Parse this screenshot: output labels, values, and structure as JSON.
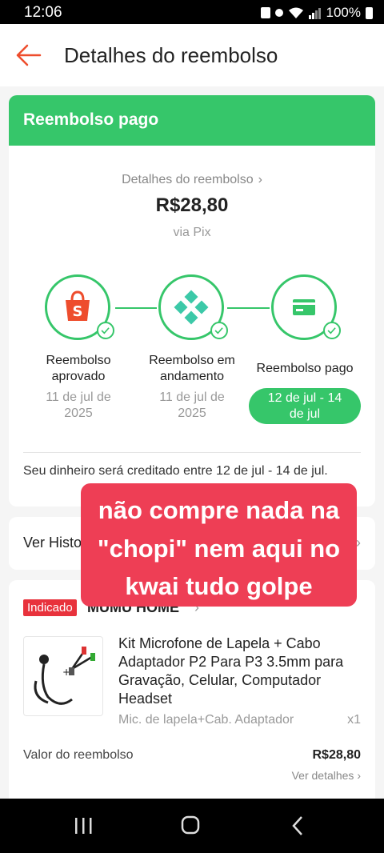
{
  "status_bar": {
    "time": "12:06",
    "battery": "100%"
  },
  "header": {
    "title": "Detalhes do reembolso"
  },
  "refund_card": {
    "banner": "Reembolso pago",
    "details_link": "Detalhes do reembolso",
    "amount": "R$28,80",
    "method": "via Pix",
    "steps": [
      {
        "label_line1": "Reembolso",
        "label_line2": "aprovado",
        "date_line1": "11 de jul de",
        "date_line2": "2025"
      },
      {
        "label_line1": "Reembolso em",
        "label_line2": "andamento",
        "date_line1": "11 de jul de",
        "date_line2": "2025"
      },
      {
        "label_line1": "Reembolso pago",
        "label_line2": "",
        "date_line1": "12 de jul - 14",
        "date_line2": "de jul"
      }
    ],
    "credit_note": "Seu dinheiro será creditado entre 12 de jul - 14 de jul."
  },
  "history": {
    "label": "Ver Histo"
  },
  "product_card": {
    "badge": "Indicado",
    "shop": "MUMU HOME",
    "product_name": "Kit Microfone de Lapela + Cabo Adaptador P2 Para P3 3.5mm para Gravação, Celular, Computador Headset",
    "variant": "Mic. de lapela+Cab. Adaptador",
    "quantity": "x1",
    "refund_label": "Valor do reembolso",
    "refund_value": "R$28,80",
    "see_details": "Ver detalhes"
  },
  "overlay": {
    "line1": "não compre nada na",
    "line2": "\"chopi\" nem aqui no",
    "line3": "kwai tudo golpe"
  },
  "colors": {
    "green": "#36c66a",
    "red_overlay": "#ee3e55",
    "shopee_orange": "#ee4d2d",
    "badge_red": "#e8323c"
  }
}
